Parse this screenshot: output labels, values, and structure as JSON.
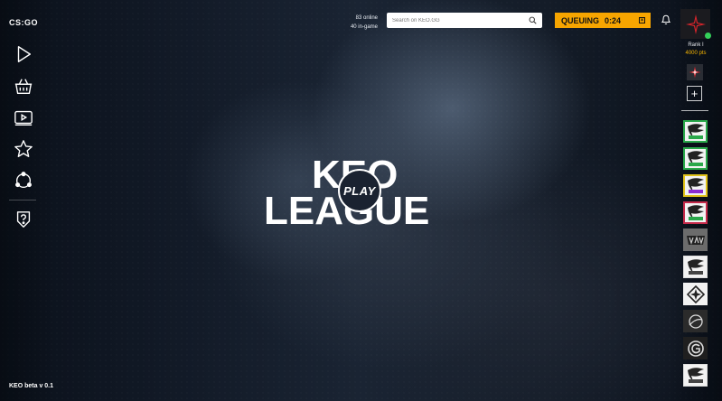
{
  "app": {
    "logo_text": "CS:GO",
    "version": "KEO beta v 0.1"
  },
  "status": {
    "online": "83 online",
    "in_game": "40 in-game"
  },
  "search": {
    "placeholder": "Search on KEO.GG"
  },
  "queue": {
    "label": "QUEUING",
    "timer": "0:24"
  },
  "profile": {
    "rank": "Rank I",
    "points": "4000 pts"
  },
  "brand": {
    "line1": "KEO",
    "line2": "LEAGUE",
    "play_label": "PLAY"
  },
  "nav": [
    "play-icon",
    "shop-basket-icon",
    "video-icon",
    "star-icon",
    "share-network-icon",
    "help-shield-icon"
  ],
  "teams": [
    "virtus-pro",
    "virtus-pro",
    "virtus-pro",
    "virtus-pro",
    "navi",
    "virtus-pro",
    "compass-team",
    "team-swoosh",
    "team-g",
    "virtus-pro"
  ],
  "colors": {
    "accent": "#f7a500",
    "online": "#34d15a",
    "points": "#f7b500",
    "team_green": "#2aa84a",
    "team_purple": "#8b2bd1"
  }
}
